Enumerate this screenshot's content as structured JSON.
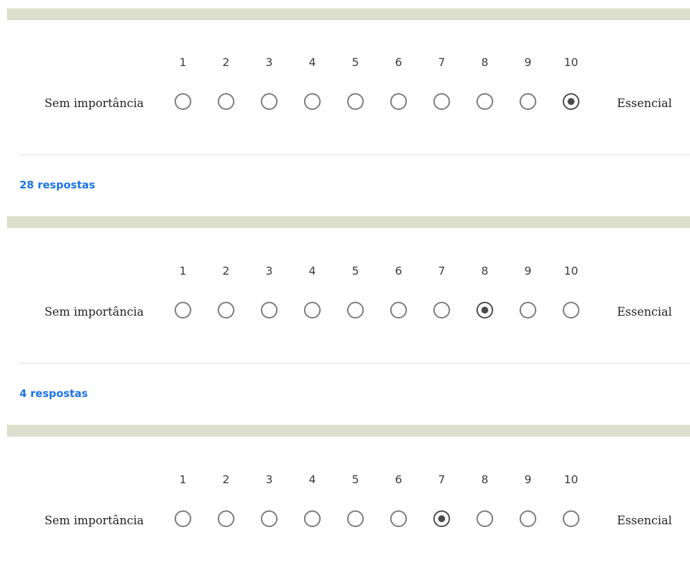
{
  "scale": {
    "numbers": [
      "1",
      "2",
      "3",
      "4",
      "5",
      "6",
      "7",
      "8",
      "9",
      "10"
    ],
    "low_label": "Sem importância",
    "high_label": "Essencial"
  },
  "sections": [
    {
      "selected_value": 10,
      "response_count_label": "28 respostas"
    },
    {
      "selected_value": 8,
      "response_count_label": "4 respostas"
    },
    {
      "selected_value": 7
    }
  ],
  "colors": {
    "band": "#dcdfcc",
    "link": "#1a73e8",
    "radio_border": "#7a7a7a",
    "radio_selected": "#4a4a4a"
  }
}
